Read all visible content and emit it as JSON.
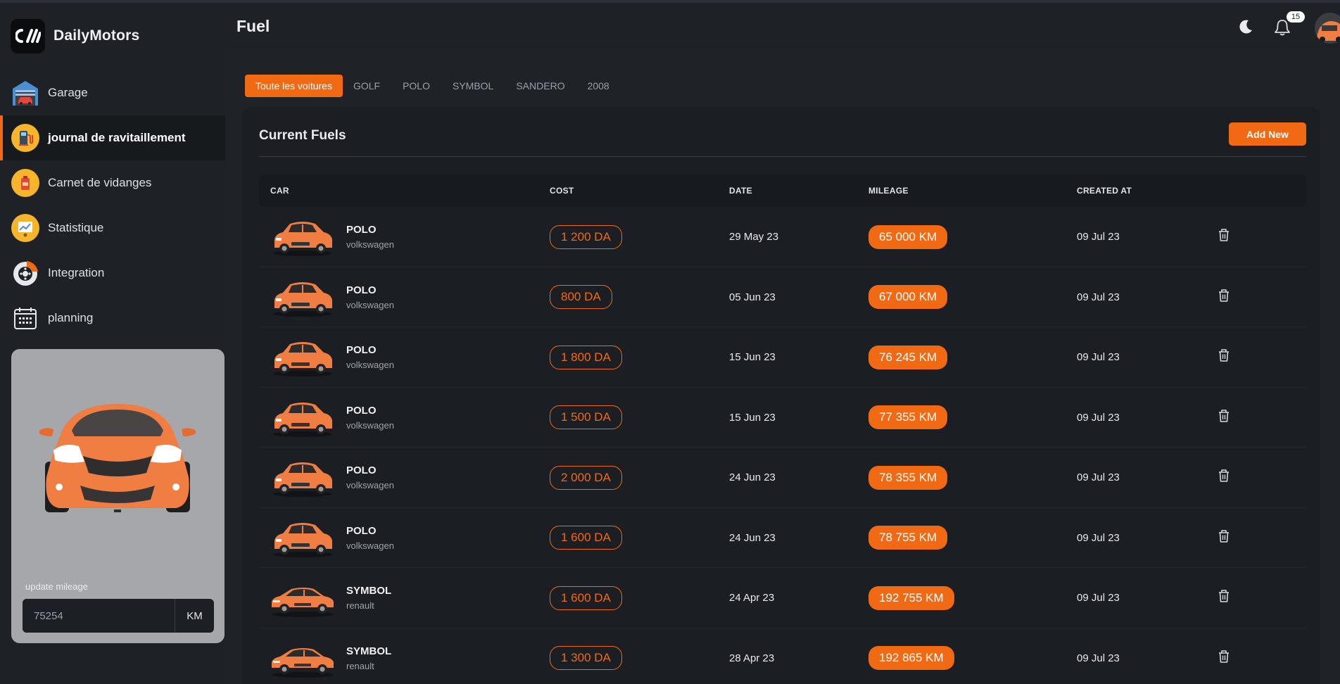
{
  "app": {
    "name": "DailyMotors"
  },
  "sidebar": {
    "items": [
      {
        "label": "Garage",
        "icon": "garage-icon",
        "active": false
      },
      {
        "label": "journal de ravitaillement",
        "icon": "fuel-pump-icon",
        "active": true
      },
      {
        "label": "Carnet de vidanges",
        "icon": "oil-can-icon",
        "active": false
      },
      {
        "label": "Statistique",
        "icon": "chart-icon",
        "active": false
      },
      {
        "label": "Integration",
        "icon": "brake-disc-icon",
        "active": false
      },
      {
        "label": "planning",
        "icon": "calendar-icon",
        "active": false
      }
    ],
    "mileage_card": {
      "label": "update mileage",
      "value": "75254",
      "unit": "KM"
    }
  },
  "header": {
    "title": "Fuel",
    "notification_count": "15"
  },
  "tabs": [
    {
      "label": "Toute les voitures",
      "active": true
    },
    {
      "label": "GOLF",
      "active": false
    },
    {
      "label": "POLO",
      "active": false
    },
    {
      "label": "SYMBOL",
      "active": false
    },
    {
      "label": "SANDERO",
      "active": false
    },
    {
      "label": "2008",
      "active": false
    }
  ],
  "panel": {
    "title": "Current Fuels",
    "add_button": "Add New"
  },
  "table": {
    "columns": [
      "CAR",
      "COST",
      "DATE",
      "MILEAGE",
      "CREATED AT"
    ],
    "rows": [
      {
        "car": "POLO",
        "brand": "volkswagen",
        "cost": "1 200 DA",
        "date": "29 May 23",
        "mileage": "65 000 KM",
        "created_at": "09 Jul 23"
      },
      {
        "car": "POLO",
        "brand": "volkswagen",
        "cost": "800 DA",
        "date": "05 Jun 23",
        "mileage": "67 000 KM",
        "created_at": "09 Jul 23"
      },
      {
        "car": "POLO",
        "brand": "volkswagen",
        "cost": "1 800 DA",
        "date": "15 Jun 23",
        "mileage": "76 245 KM",
        "created_at": "09 Jul 23"
      },
      {
        "car": "POLO",
        "brand": "volkswagen",
        "cost": "1 500 DA",
        "date": "15 Jun 23",
        "mileage": "77 355 KM",
        "created_at": "09 Jul 23"
      },
      {
        "car": "POLO",
        "brand": "volkswagen",
        "cost": "2 000 DA",
        "date": "24 Jun 23",
        "mileage": "78 355 KM",
        "created_at": "09 Jul 23"
      },
      {
        "car": "POLO",
        "brand": "volkswagen",
        "cost": "1 600 DA",
        "date": "24 Jun 23",
        "mileage": "78 755 KM",
        "created_at": "09 Jul 23"
      },
      {
        "car": "SYMBOL",
        "brand": "renault",
        "cost": "1 600 DA",
        "date": "24 Apr 23",
        "mileage": "192 755 KM",
        "created_at": "09 Jul 23"
      },
      {
        "car": "SYMBOL",
        "brand": "renault",
        "cost": "1 300 DA",
        "date": "28 Apr 23",
        "mileage": "192 865 KM",
        "created_at": "09 Jul 23"
      }
    ]
  },
  "colors": {
    "accent": "#f16a13",
    "background": "#1f2327",
    "panel": "#1b1e22"
  }
}
